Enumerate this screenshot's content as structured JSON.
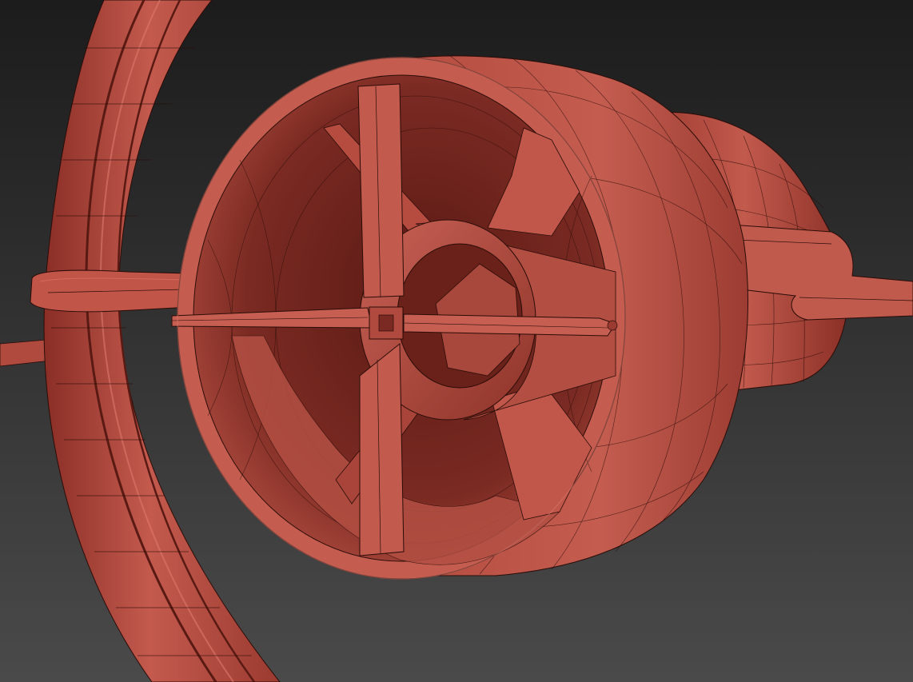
{
  "scene": {
    "subject": "3d-render-wireframe",
    "colors": {
      "background_top": "#1c1c1c",
      "background_bottom": "#4a4a4a",
      "model_base": "#b5473c",
      "model_light": "#d06a5e",
      "model_dark": "#6e2620",
      "model_shadow": "#4a1612",
      "wire": "#2a0c08"
    }
  }
}
